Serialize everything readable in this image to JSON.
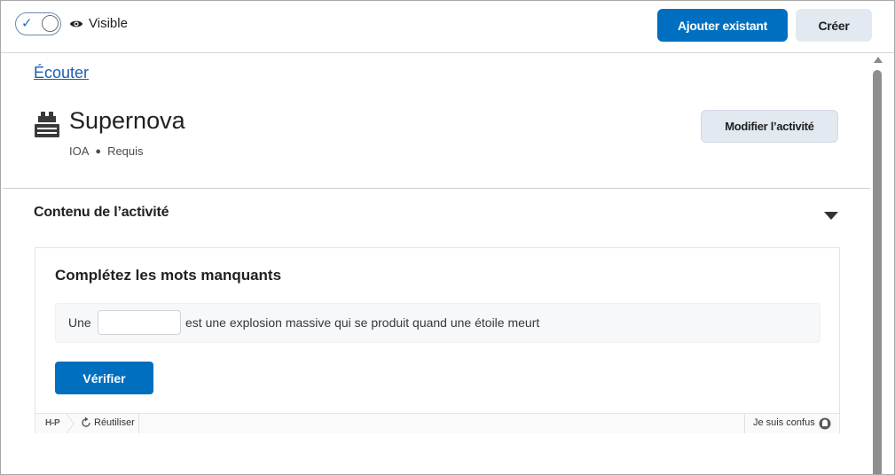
{
  "topbar": {
    "visibility_label": "Visible",
    "add_existing_label": "Ajouter existant",
    "create_label": "Créer"
  },
  "listen_link": "Écouter",
  "activity": {
    "title": "Supernova",
    "meta_type": "IOA",
    "meta_status": "Requis",
    "modify_label": "Modifier l’activité"
  },
  "content_section": {
    "heading": "Contenu de l’activité"
  },
  "h5p": {
    "title": "Complétez les mots manquants",
    "sentence_before": "Une",
    "blank_value": "",
    "sentence_after": "est une explosion massive qui se produit quand une étoile meurt",
    "verify_label": "Vérifier",
    "footer": {
      "logo_text": "H-P",
      "reuse_label": "Réutiliser",
      "confused_label": "Je suis confus"
    }
  },
  "colors": {
    "primary": "#006fbf",
    "secondary_bg": "#e3e9f1",
    "link": "#1a5fb4"
  },
  "icons": [
    "checkmark-icon",
    "eye-icon",
    "activity-blocks-icon",
    "chevron-down-icon",
    "reload-icon",
    "help-icon"
  ]
}
